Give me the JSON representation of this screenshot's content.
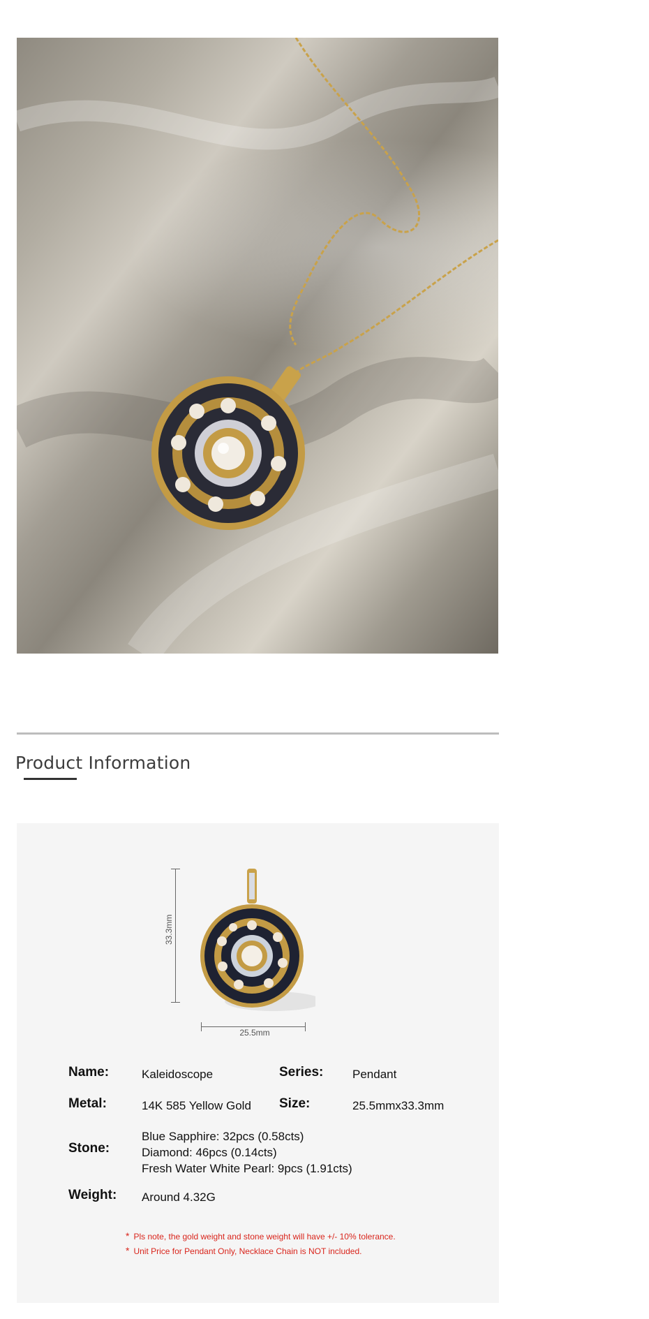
{
  "section_title": "Product Information",
  "dimensions": {
    "height": "33.3mm",
    "width": "25.5mm"
  },
  "specs": {
    "name_label": "Name:",
    "name_value": "Kaleidoscope",
    "series_label": "Series:",
    "series_value": "Pendant",
    "metal_label": "Metal:",
    "metal_value": "14K 585 Yellow Gold",
    "size_label": "Size:",
    "size_value": "25.5mmx33.3mm",
    "stone_label": "Stone:",
    "stone_values": [
      "Blue Sapphire: 32pcs (0.58cts)",
      "Diamond: 46pcs (0.14cts)",
      "Fresh Water White Pearl: 9pcs (1.91cts)"
    ],
    "weight_label": "Weight:",
    "weight_value": "Around 4.32G"
  },
  "notes": [
    "Pls note, the gold weight and stone weight will have +/- 10% tolerance.",
    "Unit Price for Pendant Only, Necklace Chain is NOT included."
  ],
  "colors": {
    "note_red": "#d9251c",
    "panel_bg": "#f5f5f5",
    "gold": "#c9a24a",
    "sapphire": "#1e2232"
  }
}
